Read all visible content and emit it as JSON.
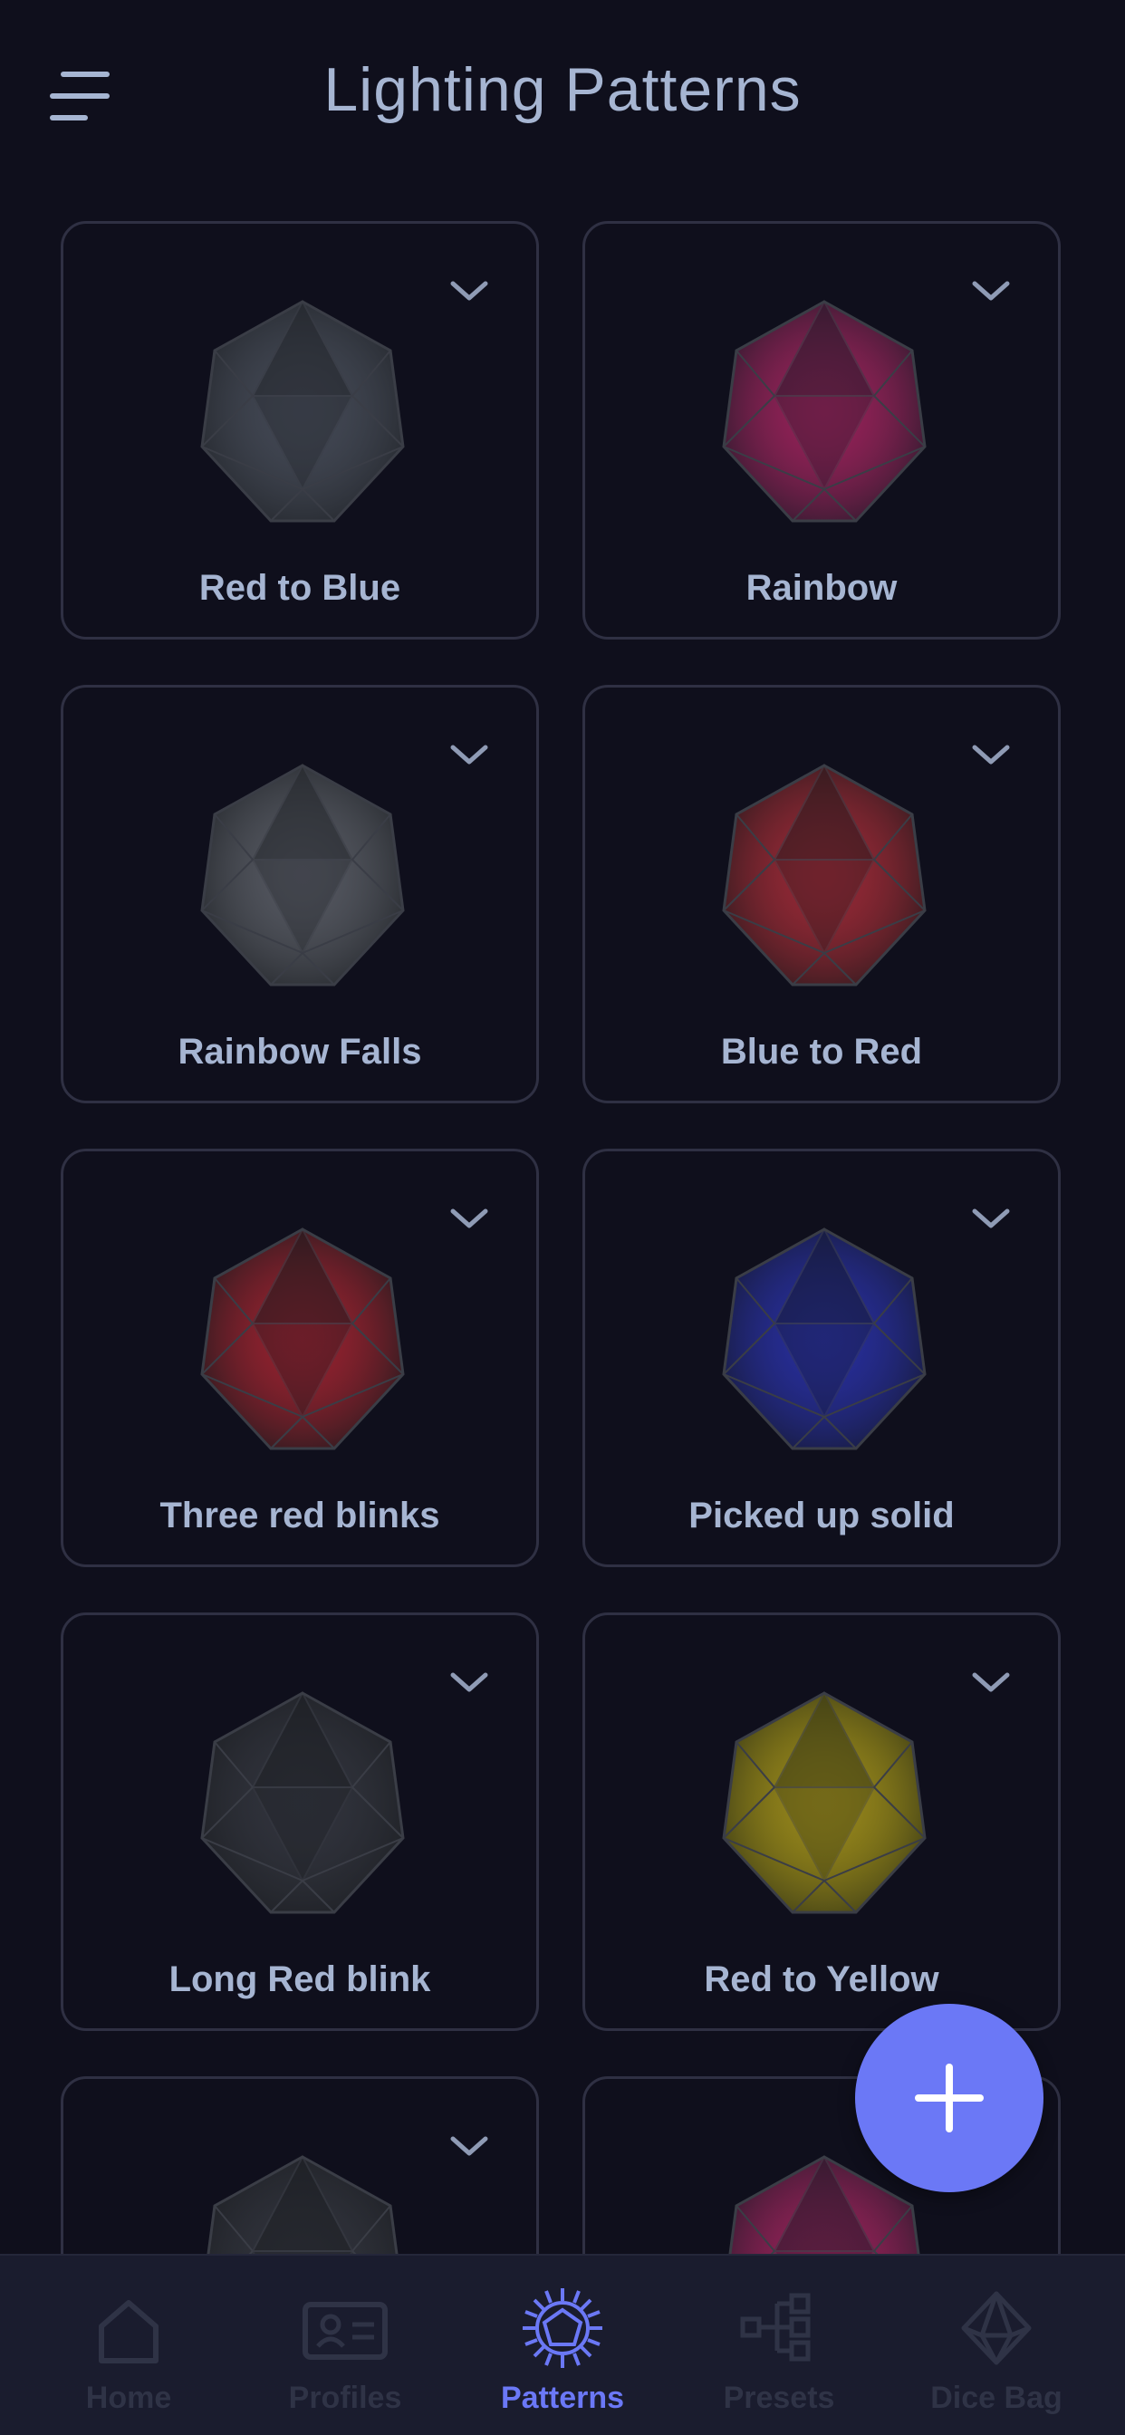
{
  "header": {
    "title": "Lighting Patterns"
  },
  "patterns": [
    {
      "label": "Red to Blue",
      "glow": "#6a7380",
      "base": "#23262c"
    },
    {
      "label": "Rainbow",
      "glow": "#ff2f86",
      "base": "#2a1a2c"
    },
    {
      "label": "Rainbow Falls",
      "glow": "#8a8f96",
      "base": "#24272c"
    },
    {
      "label": "Blue to Red",
      "glow": "#ff3b4a",
      "base": "#2c1a1e"
    },
    {
      "label": "Three red blinks",
      "glow": "#ff2e3e",
      "base": "#221a1e"
    },
    {
      "label": "Picked up solid",
      "glow": "#3a45ff",
      "base": "#161a36"
    },
    {
      "label": "Long Red blink",
      "glow": "#4a4e56",
      "base": "#1d1f24"
    },
    {
      "label": "Red to Yellow",
      "glow": "#ffe21a",
      "base": "#3a3a16"
    },
    {
      "label": "",
      "glow": "#4a4e56",
      "base": "#1d1f24"
    },
    {
      "label": "",
      "glow": "#ff2f86",
      "base": "#2a1a2c"
    }
  ],
  "fab": {
    "icon": "plus-icon"
  },
  "nav": {
    "items": [
      {
        "label": "Home",
        "icon": "home-icon"
      },
      {
        "label": "Profiles",
        "icon": "profile-card-icon"
      },
      {
        "label": "Patterns",
        "icon": "patterns-icon"
      },
      {
        "label": "Presets",
        "icon": "presets-icon"
      },
      {
        "label": "Dice Bag",
        "icon": "dice-bag-icon"
      }
    ],
    "active": "Patterns"
  },
  "colors": {
    "background": "#0f0f1c",
    "accent": "#6b78f6",
    "text": "#a6b5d2",
    "inactive_nav": "#2f3346"
  }
}
